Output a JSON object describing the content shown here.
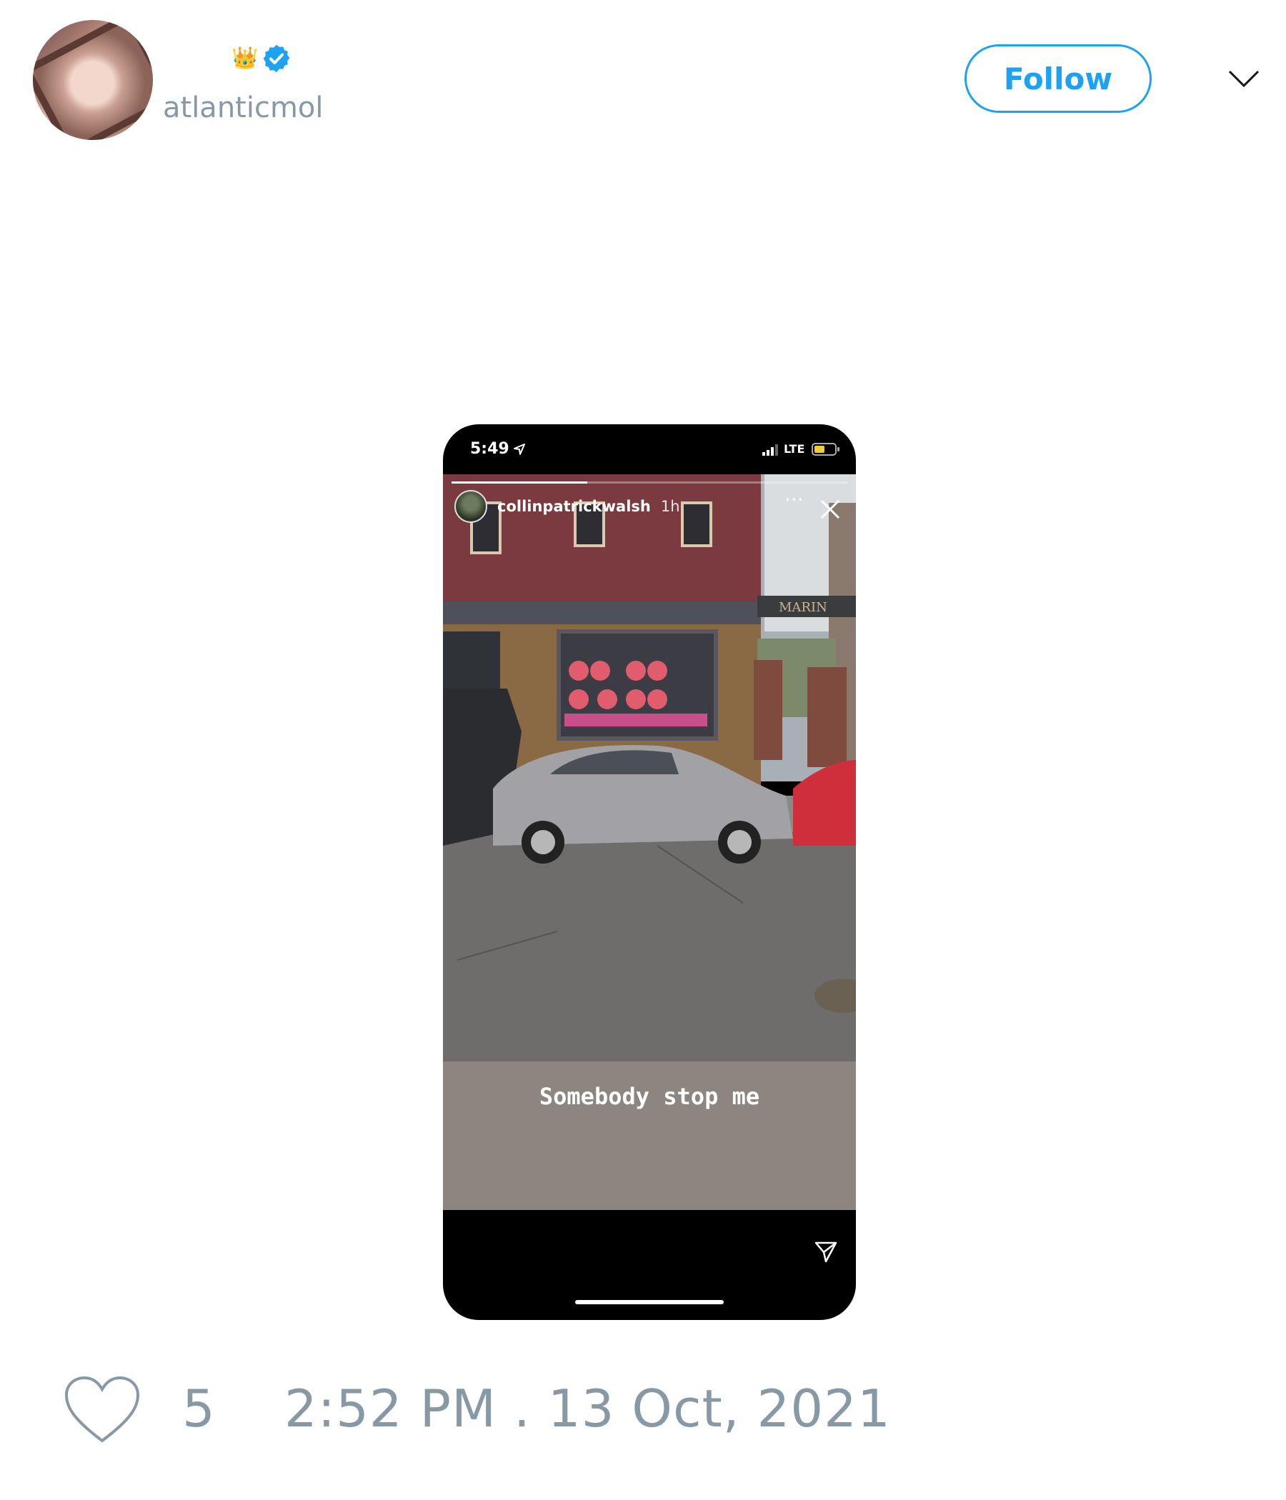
{
  "header": {
    "display_emoji": "👑",
    "handle": "atlanticmol",
    "follow_label": "Follow"
  },
  "story": {
    "status_time": "5:49",
    "network": "LTE",
    "username": "collinpatrickwalsh",
    "posted_ago": "1h",
    "more_label": "···",
    "storefront_sign": "MARIN",
    "caption": "Somebody stop me"
  },
  "footer": {
    "like_count": "5",
    "timestamp": "2:52 PM . 13 Oct, 2021"
  },
  "colors": {
    "accent": "#1da1f2",
    "muted_text": "#8899a6",
    "caption_band": "#8d8580"
  },
  "icons": {
    "verified": "verified-badge-icon",
    "menu": "chevron-down-icon",
    "like": "heart-icon",
    "close": "close-icon",
    "send": "send-icon"
  }
}
